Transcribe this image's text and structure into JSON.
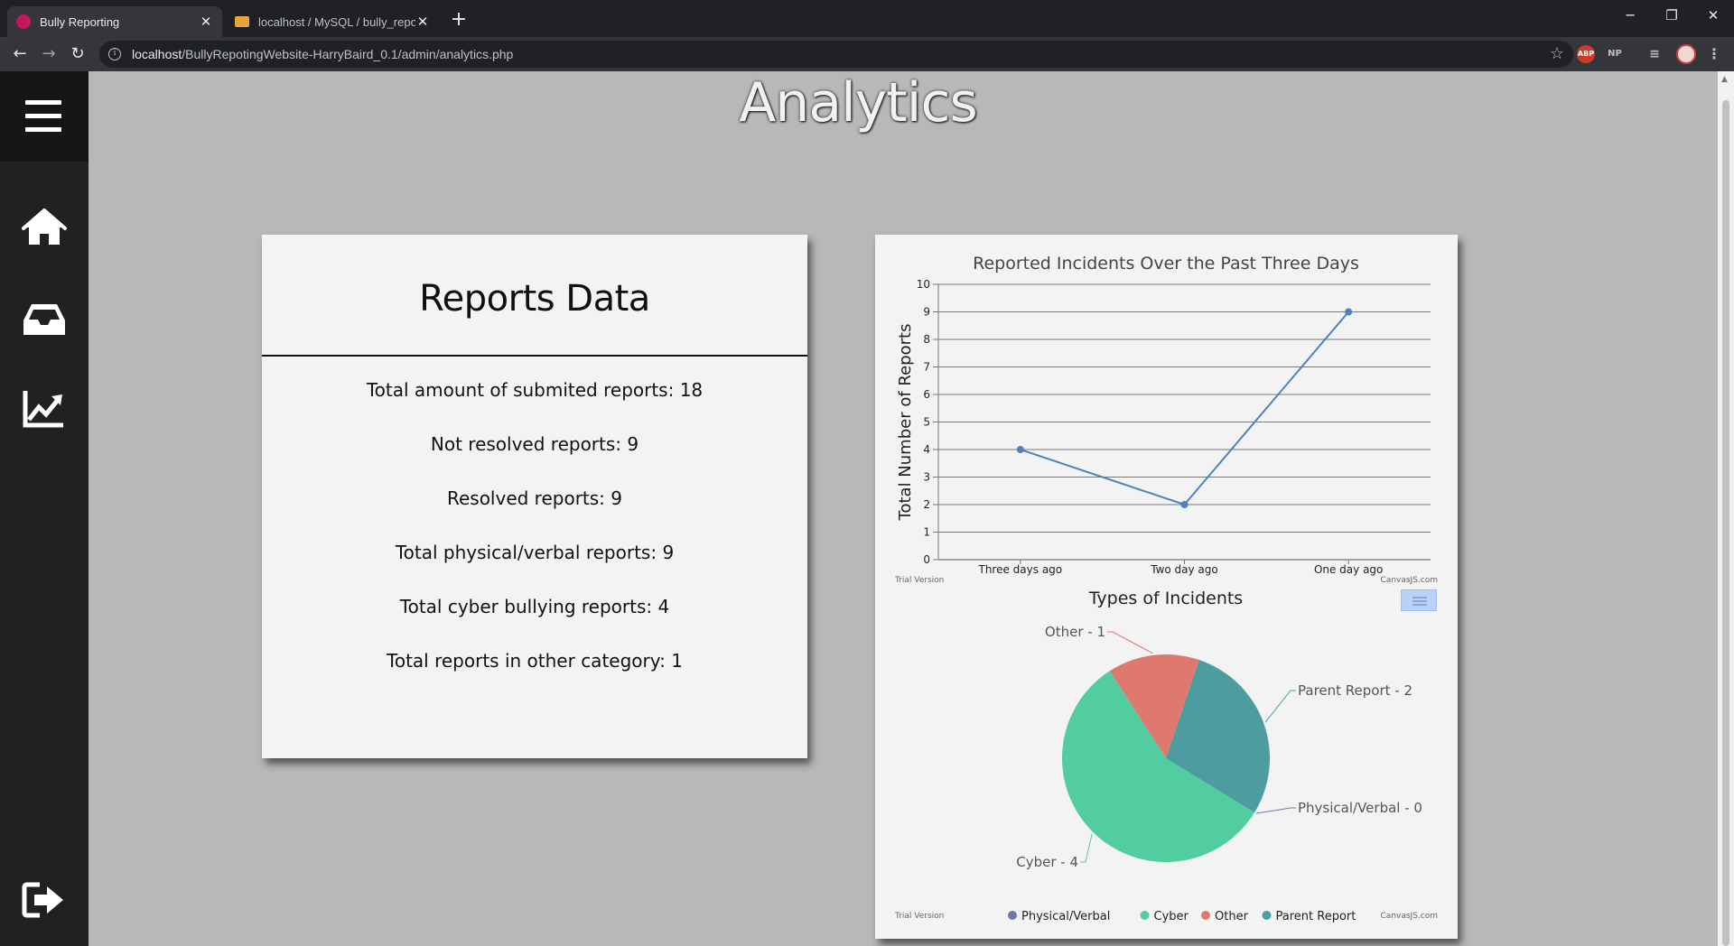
{
  "browser": {
    "tabs": [
      {
        "title": "Bully Reporting",
        "active": true,
        "favicon_color": "#c2185b"
      },
      {
        "title": "localhost / MySQL / bully_reporti",
        "active": false,
        "favicon_color": "#e8a33c"
      }
    ],
    "new_tab": "+",
    "window": {
      "minimize": "─",
      "restore": "❐",
      "close": "✕"
    },
    "nav": {
      "back": "←",
      "forward": "→",
      "reload": "↻"
    },
    "address": {
      "host": "localhost",
      "path": "/BullyRepotingWebsite-HarryBaird_0.1/admin/analytics.php"
    },
    "extensions": {
      "abp": "ABP",
      "np": "NP",
      "media": "≡",
      "menu": "⋮"
    }
  },
  "sidebar": {
    "items": [
      {
        "icon": "hamburger-menu-icon"
      },
      {
        "icon": "home-icon"
      },
      {
        "icon": "inbox-icon"
      },
      {
        "icon": "analytics-chart-icon"
      },
      {
        "icon": "logout-icon"
      }
    ]
  },
  "page": {
    "title": "Analytics"
  },
  "reports": {
    "heading": "Reports Data",
    "lines": [
      "Total amount of submited reports: 18",
      "Not resolved reports: 9",
      "Resolved reports: 9",
      "Total physical/verbal reports: 9",
      "Total cyber bullying reports: 4",
      "Total reports in other category: 1"
    ]
  },
  "watermarks": {
    "trial": "Trial Version",
    "brand": "CanvasJS.com"
  },
  "colors": {
    "line": "#4f81bc",
    "physical": "#6d78ad",
    "cyber": "#51cda0",
    "other": "#df7970",
    "parent": "#4c9ca0"
  },
  "chart_data": [
    {
      "type": "line",
      "title": "Reported Incidents Over the Past Three Days",
      "xlabel": "",
      "ylabel": "Total Number of Reports",
      "categories": [
        "Three days ago",
        "Two day ago",
        "One day ago"
      ],
      "values": [
        4,
        2,
        9
      ],
      "ylim": [
        0,
        10
      ],
      "yticks": [
        0,
        1,
        2,
        3,
        4,
        5,
        6,
        7,
        8,
        9,
        10
      ],
      "grid": true
    },
    {
      "type": "pie",
      "title": "Types of Incidents",
      "slices": [
        {
          "label": "Physical/Verbal",
          "value": 0,
          "index_label": "Physical/Verbal - 0"
        },
        {
          "label": "Cyber",
          "value": 4,
          "index_label": "Cyber - 4"
        },
        {
          "label": "Other",
          "value": 1,
          "index_label": "Other - 1"
        },
        {
          "label": "Parent Report",
          "value": 2,
          "index_label": "Parent Report - 2"
        }
      ],
      "legend": "bottom"
    }
  ]
}
